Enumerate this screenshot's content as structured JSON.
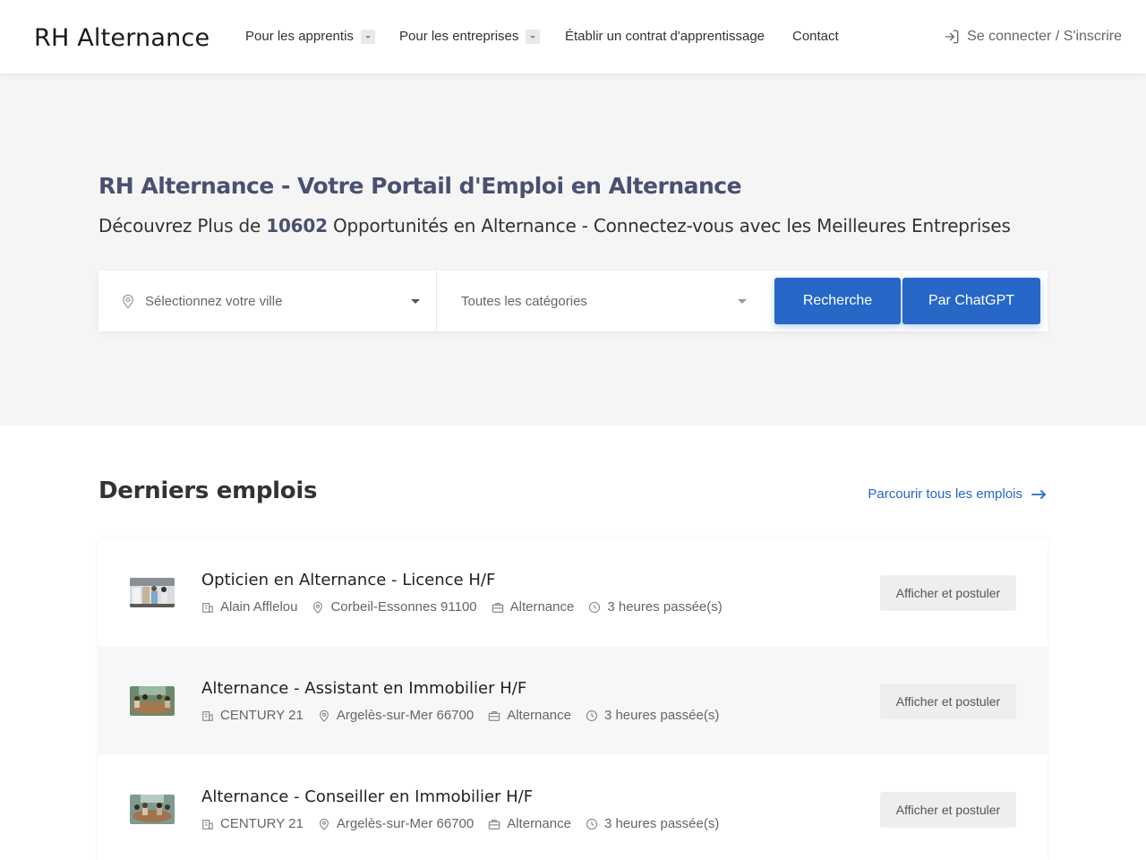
{
  "header": {
    "logo": "RH Alternance",
    "nav": [
      {
        "label": "Pour les apprentis",
        "has_dropdown": true
      },
      {
        "label": "Pour les entreprises",
        "has_dropdown": true
      },
      {
        "label": "Établir un contrat d'apprentissage",
        "has_dropdown": false
      },
      {
        "label": "Contact",
        "has_dropdown": false
      }
    ],
    "login_label": "Se connecter / S'inscrire",
    "login_icon": "login-icon"
  },
  "hero": {
    "title": "RH Alternance - Votre Portail d'Emploi en Alternance",
    "subtitle_prefix": "Découvrez Plus de ",
    "subtitle_count": "10602",
    "subtitle_suffix": " Opportunités en Alternance - Connectez-vous avec les Meilleures Entreprises"
  },
  "search": {
    "city_placeholder": "Sélectionnez votre ville",
    "category_placeholder": "Toutes les catégories",
    "search_button": "Recherche",
    "gpt_button": "Par ChatGPT",
    "accent_color": "#2667c7"
  },
  "jobs": {
    "title": "Derniers emplois",
    "browse_label": "Parcourir tous les emplois",
    "apply_label": "Afficher et postuler",
    "items": [
      {
        "title": "Opticien en Alternance - Licence H/F",
        "company": "Alain Afflelou",
        "location": "Corbeil-Essonnes 91100",
        "type": "Alternance",
        "posted": "3 heures passée(s)"
      },
      {
        "title": "Alternance - Assistant en Immobilier H/F",
        "company": "CENTURY 21",
        "location": "Argelès-sur-Mer 66700",
        "type": "Alternance",
        "posted": "3 heures passée(s)"
      },
      {
        "title": "Alternance - Conseiller en Immobilier H/F",
        "company": "CENTURY 21",
        "location": "Argelès-sur-Mer 66700",
        "type": "Alternance",
        "posted": "3 heures passée(s)"
      }
    ]
  }
}
